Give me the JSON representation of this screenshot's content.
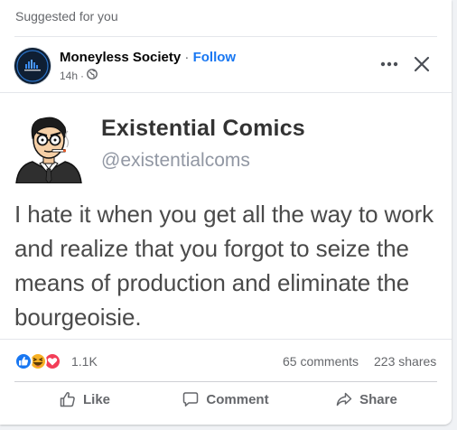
{
  "header": {
    "suggested_label": "Suggested for you"
  },
  "post": {
    "page_name": "Moneyless Society",
    "separator": "·",
    "follow_label": "Follow",
    "time": "14h",
    "time_separator": "·",
    "privacy_icon": "globe-icon",
    "more_icon": "more-options-icon",
    "close_icon": "close-icon"
  },
  "embedded_tweet": {
    "author_name": "Existential Comics",
    "author_handle": "@existentialcoms",
    "text": "I hate it when you get all the way to work and realize that you forgot to seize the means of production and eliminate the bourgeoisie."
  },
  "engagement": {
    "reaction_icons": [
      "like-reaction-icon",
      "haha-reaction-icon",
      "love-reaction-icon"
    ],
    "reaction_count": "1.1K",
    "comments": "65 comments",
    "shares": "223 shares"
  },
  "actions": {
    "like_label": "Like",
    "comment_label": "Comment",
    "share_label": "Share"
  },
  "colors": {
    "accent": "#1877f2",
    "secondary_text": "#65676b",
    "like_blue": "#1877f2",
    "love_red": "#f33e58",
    "haha_yellow": "#f7b125"
  }
}
